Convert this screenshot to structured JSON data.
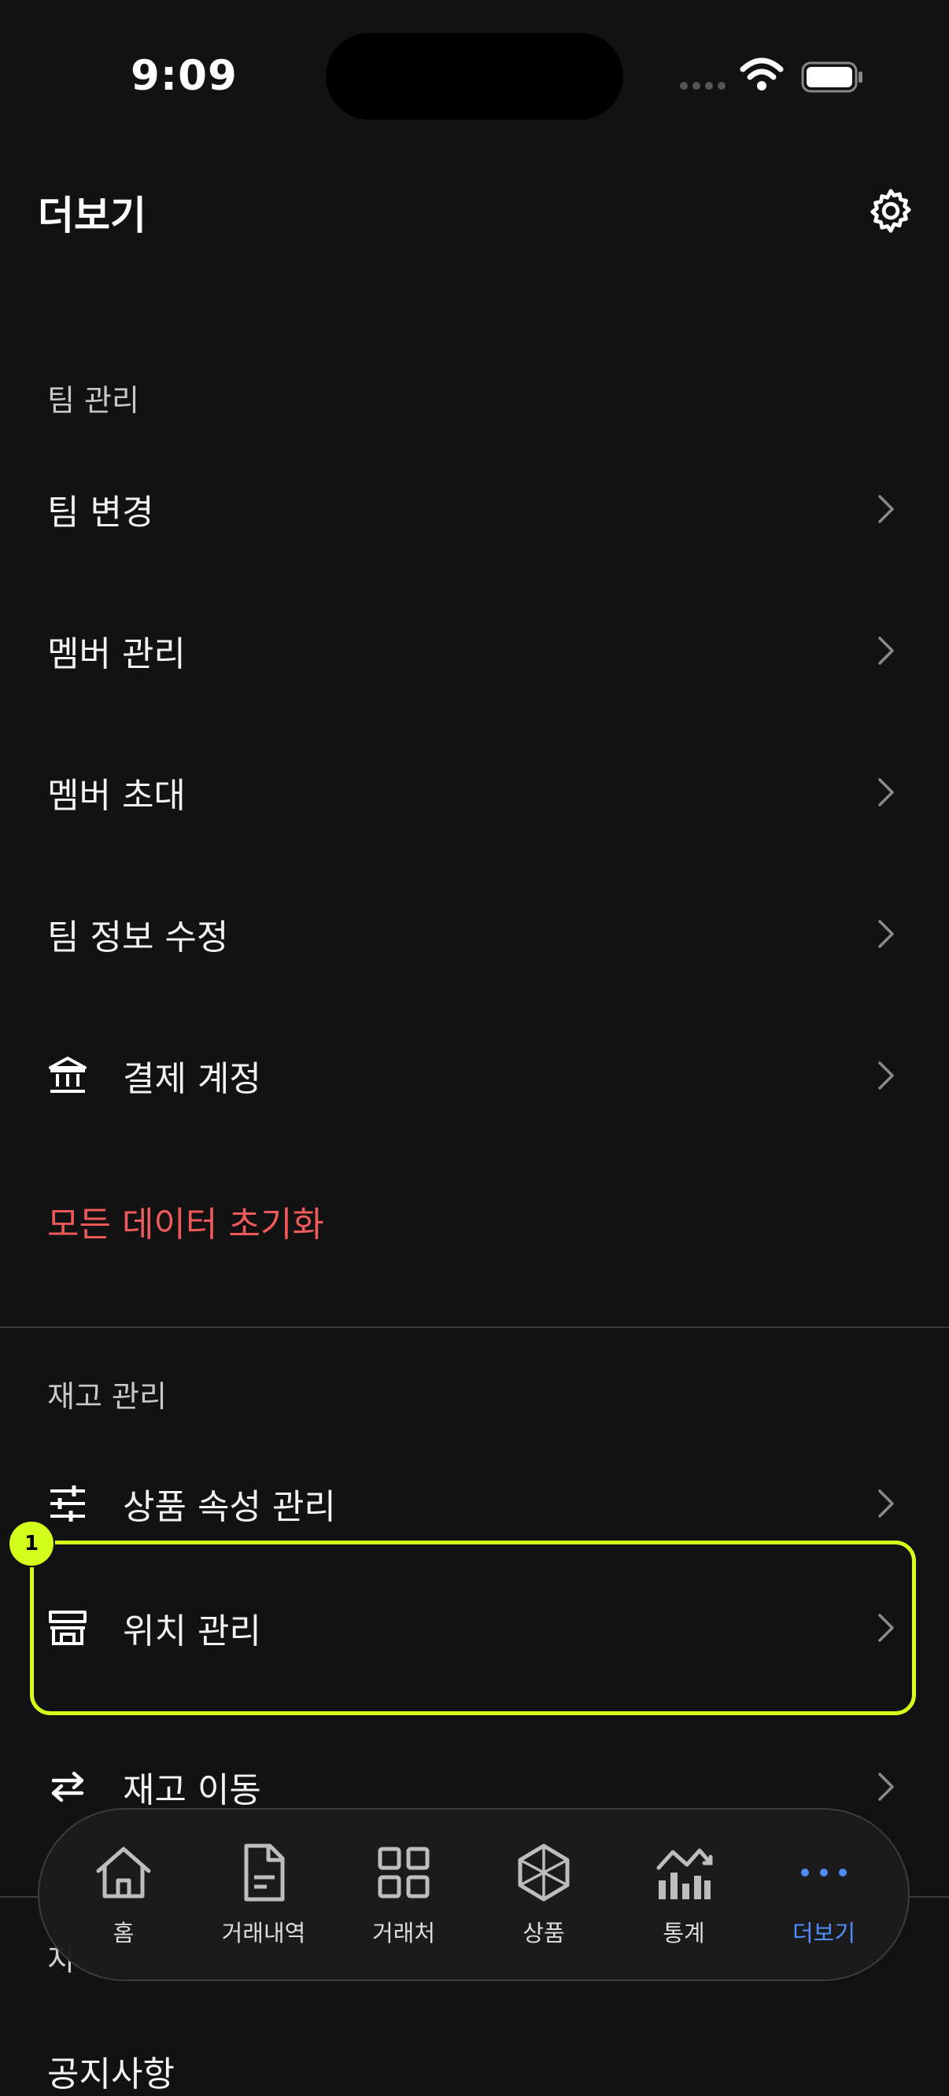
{
  "status_bar": {
    "time": "9:09"
  },
  "header": {
    "title": "더보기",
    "settings_icon": "gear-icon"
  },
  "team_section": {
    "label": "팀 관리",
    "items": [
      {
        "label": "팀 변경"
      },
      {
        "label": "멤버 관리"
      },
      {
        "label": "멤버 초대"
      },
      {
        "label": "팀 정보 수정"
      },
      {
        "label": "결제 계정",
        "icon": "bank-icon"
      }
    ],
    "danger_action": "모든 데이터 초기화"
  },
  "inventory_section": {
    "label": "재고 관리",
    "items": [
      {
        "label": "상품 속성 관리",
        "icon": "sliders-icon"
      },
      {
        "label": "위치 관리",
        "icon": "store-icon"
      },
      {
        "label": "재고 이동",
        "icon": "transfer-icon"
      }
    ]
  },
  "annotation": {
    "badge": "1"
  },
  "peek": {
    "section_label_partial": "지",
    "item_partial": "공지사항"
  },
  "tab_bar": {
    "items": [
      {
        "label": "홈",
        "icon": "home-icon"
      },
      {
        "label": "거래내역",
        "icon": "document-icon"
      },
      {
        "label": "거래처",
        "icon": "grid-icon"
      },
      {
        "label": "상품",
        "icon": "box-icon"
      },
      {
        "label": "통계",
        "icon": "stats-icon"
      },
      {
        "label": "더보기",
        "icon": "more-icon",
        "active": true
      }
    ]
  },
  "colors": {
    "accent": "#4f8ef7",
    "danger": "#ee5a5a",
    "highlight": "#d4ff1a",
    "background": "#121212"
  }
}
